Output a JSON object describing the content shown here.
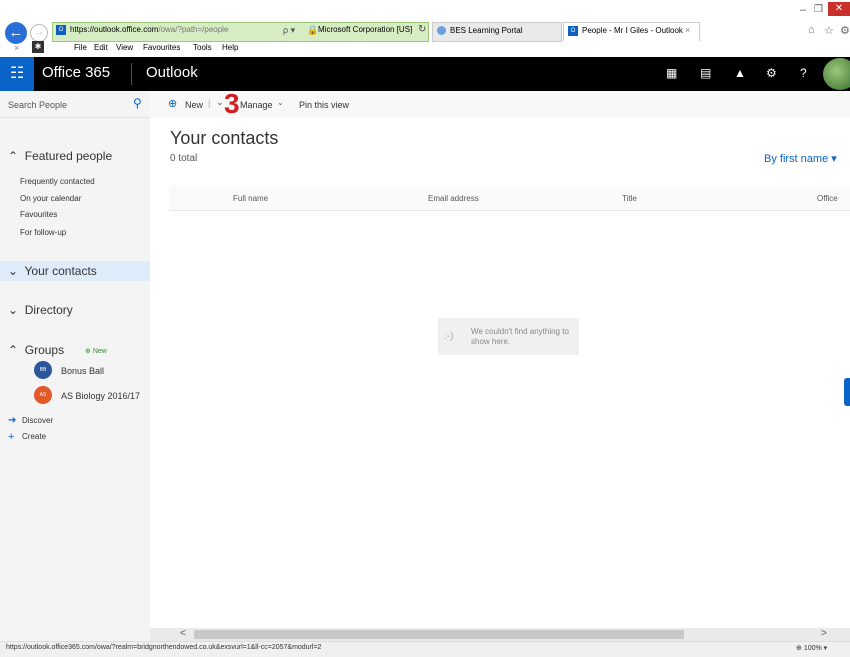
{
  "browser": {
    "url_host": "https://outlook.office.com",
    "url_path": "/owa/?path=/people",
    "search_dropdown": "ρ ▾",
    "certificate": "Microsoft Corporation [US]",
    "tabs": [
      {
        "label": "BES Learning Portal"
      },
      {
        "label": "People - Mr I Giles - Outlook"
      }
    ],
    "tab_close": "×",
    "menu": {
      "file": "File",
      "edit": "Edit",
      "view": "View",
      "favourites": "Favourites",
      "tools": "Tools",
      "help": "Help"
    },
    "status_url": "https://outlook.office365.com/owa/?realm=bridgnorthendowed.co.uk&exsvurl=1&ll-cc=2057&modurl=2",
    "zoom": "100%"
  },
  "suite_bar": {
    "brand": "Office 365",
    "app": "Outlook"
  },
  "sidebar": {
    "search_placeholder": "Search People",
    "featured": {
      "label": "Featured people",
      "items": [
        "Frequently contacted",
        "On your calendar",
        "Favourites",
        "For follow-up"
      ]
    },
    "your_contacts": "Your contacts",
    "directory": "Directory",
    "groups": {
      "label": "Groups",
      "badge": "New",
      "items": [
        {
          "initials": "BB",
          "label": "Bonus Ball",
          "color": "#2b579a"
        },
        {
          "initials": "AS",
          "label": "AS Biology 2016/17",
          "color": "#e05a2a"
        }
      ]
    },
    "discover": "Discover",
    "create": "Create"
  },
  "toolbar": {
    "new": "New",
    "separator": "|",
    "manage": "Manage",
    "pin": "Pin this view",
    "overlay_number": "3"
  },
  "main": {
    "title": "Your contacts",
    "count": "0 total",
    "sort": "By first name",
    "columns": [
      "Full name",
      "Email address",
      "Title",
      "Office"
    ],
    "empty_message": "We couldn't find anything to show here.",
    "empty_face": ":-)"
  },
  "colors": {
    "accent": "#0a63c9",
    "suite_bar": "#000000",
    "overlay": "#d02020"
  }
}
